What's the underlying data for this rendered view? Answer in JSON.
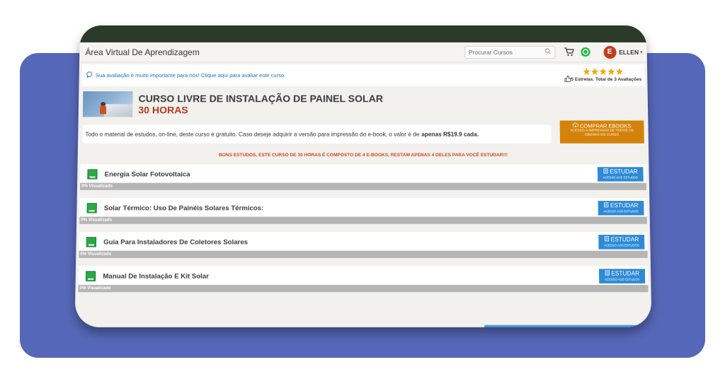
{
  "navbar": {
    "brand": "Área Virtual De Aprendizagem",
    "search_placeholder": "Procurar Cursos",
    "user_initial": "E",
    "user_name": "ELLEN"
  },
  "rating": {
    "message": "Sua avaliação é muito importante para nós! Clique aqui para avaliar este curso.",
    "stars": "★★★★★",
    "summary": "5 Estrelas. Total de 3 Avaliações"
  },
  "course": {
    "title": "CURSO LIVRE DE INSTALAÇÃO DE PAINEL SOLAR",
    "hours": "30 HORAS",
    "info_prefix": "Todo o material de estudos, on-line, deste curso é gratuito. Caso deseje adquirir a versão para impressão do e-book, o valor é de",
    "info_price": "apenas R$19.9 cada.",
    "buy_label": "COMPRAR EBOOKS",
    "buy_sub": "ACESSO À IMPRESSÃO DE TODOS OS EBOOKS DO CURSO",
    "notice": "BONS ESTUDOS, ESTE CURSO DE 30 HORAS É COMPOSTO DE 4 E-BOOKS, RESTAM APENAS 4 DELES PARA VOCÊ ESTUDAR!!!"
  },
  "modules": [
    {
      "title": "Energia Solar Fotovoltaica",
      "progress_label": "0% Visualizado",
      "progress": 0
    },
    {
      "title": "Solar Térmico: Uso De Painéis Solares Térmicos:",
      "progress_label": "0% Visualizado",
      "progress": 0
    },
    {
      "title": "Guia Para Instaladores De Coletores Solares",
      "progress_label": "0% Visualizado",
      "progress": 0
    },
    {
      "title": "Manual De Instalação E Kit Solar",
      "progress_label": "0% Visualizado",
      "progress": 0
    }
  ],
  "study_button": {
    "label": "ESTUDAR",
    "sub": "ACESSO AOS ESTUDOS"
  },
  "colors": {
    "accent_blue": "#2e8ad6",
    "buy_orange": "#d4830a",
    "title_red": "#b5391a",
    "background_panel": "#5567b8"
  }
}
